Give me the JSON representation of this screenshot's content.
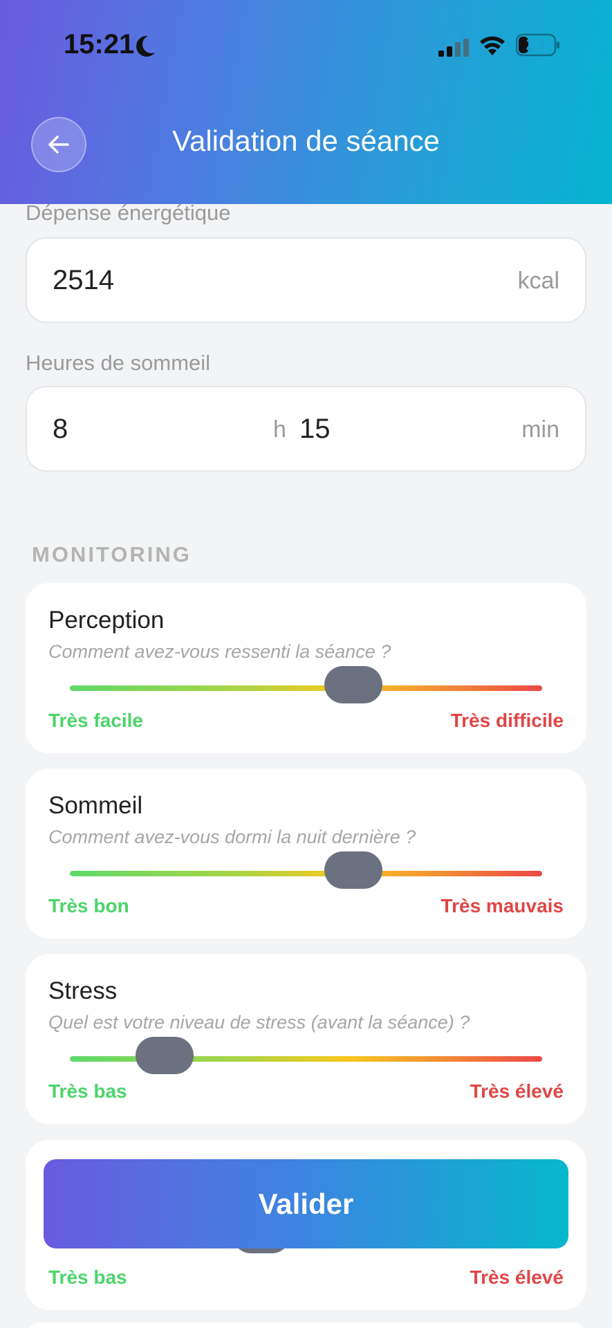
{
  "status_bar": {
    "time": "15:21",
    "battery": "23",
    "icons": [
      "moon-icon",
      "signal-icon",
      "wifi-icon",
      "battery-icon"
    ]
  },
  "header": {
    "title": "Validation de séance",
    "back_icon": "arrow-left-icon"
  },
  "fields": {
    "energy": {
      "label": "Dépense énergétique",
      "value": "2514",
      "unit": "kcal"
    },
    "sleep_hours": {
      "label": "Heures de sommeil",
      "hours": "8",
      "hours_unit": "h",
      "minutes": "15",
      "minutes_unit": "min"
    }
  },
  "monitoring": {
    "section_title": "MONITORING",
    "items": [
      {
        "title": "Perception",
        "subtitle": "Comment avez-vous ressenti la séance ?",
        "min_label": "Très facile",
        "max_label": "Très difficile",
        "value": 0.6
      },
      {
        "title": "Sommeil",
        "subtitle": "Comment avez-vous dormi la nuit dernière ?",
        "min_label": "Très bon",
        "max_label": "Très mauvais",
        "value": 0.6
      },
      {
        "title": "Stress",
        "subtitle": "Quel est votre niveau de stress (avant la séance) ?",
        "min_label": "Très bas",
        "max_label": "Très élevé",
        "value": 0.2
      },
      {
        "min_label": "Très bas",
        "max_label": "Très élevé"
      }
    ]
  },
  "actions": {
    "validate_label": "Valider"
  },
  "colors": {
    "gradient_start": "#6a5ae0",
    "gradient_end": "#05b4d0",
    "low": "#4cd46a",
    "high": "#e04646",
    "thumb": "#6b717e"
  }
}
